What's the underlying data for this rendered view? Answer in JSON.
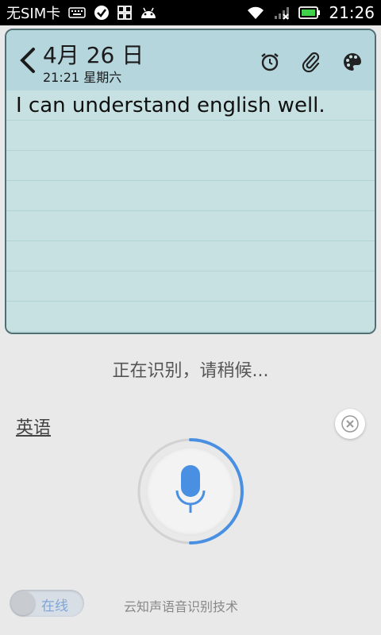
{
  "statusbar": {
    "carrier": "无SIM卡",
    "time": "21:26",
    "icons": [
      "keyboard-icon",
      "check-circle-icon",
      "grid-icon",
      "android-icon",
      "wifi-icon",
      "signal-icon",
      "battery-icon"
    ]
  },
  "note": {
    "date": "4月 26 日",
    "time": "21:21 星期六",
    "text": "I can understand english well.",
    "header_icons": [
      "alarm-icon",
      "paperclip-icon",
      "palette-icon"
    ]
  },
  "voice": {
    "status": "正在识别，请稍候...",
    "language": "英语",
    "toggle_label": "在线",
    "credit": "云知声语音识别技术",
    "accent_color": "#4a90e2"
  }
}
